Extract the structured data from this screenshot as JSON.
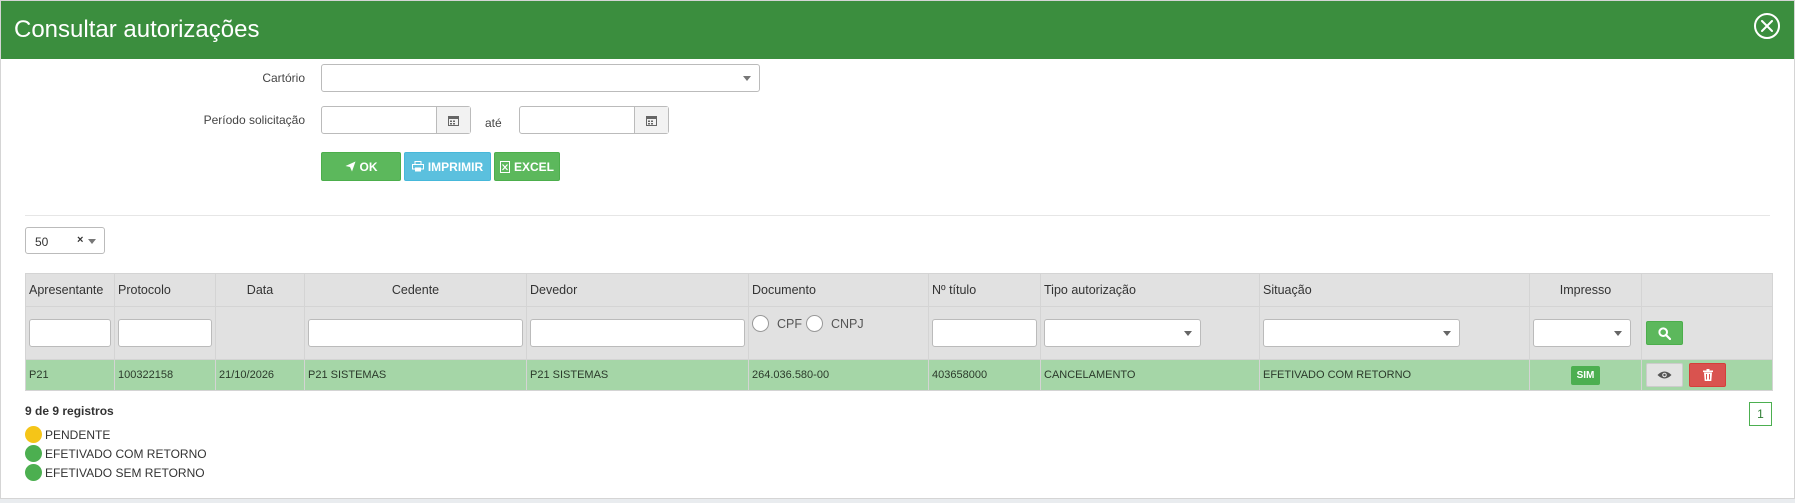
{
  "header": {
    "title": "Consultar autorizações"
  },
  "form": {
    "cartorio_label": "Cartório",
    "periodo_label": "Período solicitação",
    "ate_label": "até",
    "buttons": {
      "ok": "OK",
      "print": "IMPRIMIR",
      "excel": "EXCEL"
    }
  },
  "page_size": "50",
  "table": {
    "columns": [
      "Apresentante",
      "Protocolo",
      "Data",
      "Cedente",
      "Devedor",
      "Documento",
      "Nº título",
      "Tipo autorização",
      "Situação",
      "Impresso"
    ],
    "doc_options": {
      "cpf": "CPF",
      "cnpj": "CNPJ"
    },
    "rows": [
      {
        "apresentante": "P21",
        "protocolo": "100322158",
        "data": "21/10/2026",
        "cedente": "P21 SISTEMAS",
        "devedor": "P21 SISTEMAS",
        "documento": "264.036.580-00",
        "titulo": "403658000",
        "tipo": "CANCELAMENTO",
        "situacao": "EFETIVADO COM RETORNO",
        "impresso": "SIM"
      }
    ]
  },
  "records_info": "9 de 9 registros",
  "legend": [
    {
      "label": "PENDENTE",
      "color": "#f5c518"
    },
    {
      "label": "EFETIVADO COM RETORNO",
      "color": "#4caf50"
    },
    {
      "label": "EFETIVADO SEM RETORNO",
      "color": "#4caf50"
    }
  ],
  "pager": {
    "current": "1"
  }
}
